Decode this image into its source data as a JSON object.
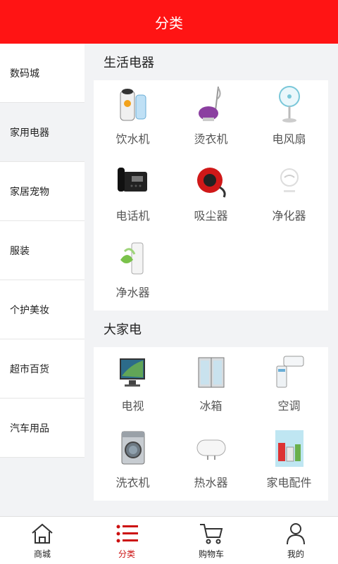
{
  "header": {
    "title": "分类"
  },
  "sidebar": {
    "items": [
      {
        "label": "数码城"
      },
      {
        "label": "家用电器"
      },
      {
        "label": "家居宠物"
      },
      {
        "label": "服装"
      },
      {
        "label": "个护美妆"
      },
      {
        "label": "超市百货"
      },
      {
        "label": "汽车用品"
      }
    ],
    "active_index": 1
  },
  "sections": [
    {
      "title": "生活电器",
      "items": [
        {
          "label": "饮水机",
          "icon": "water-dispenser-icon"
        },
        {
          "label": "烫衣机",
          "icon": "garment-steamer-icon"
        },
        {
          "label": "电风扇",
          "icon": "electric-fan-icon"
        },
        {
          "label": "电话机",
          "icon": "telephone-icon"
        },
        {
          "label": "吸尘器",
          "icon": "vacuum-cleaner-icon"
        },
        {
          "label": "净化器",
          "icon": "air-purifier-icon"
        },
        {
          "label": "净水器",
          "icon": "water-purifier-icon"
        }
      ]
    },
    {
      "title": "大家电",
      "items": [
        {
          "label": "电视",
          "icon": "television-icon"
        },
        {
          "label": "冰箱",
          "icon": "refrigerator-icon"
        },
        {
          "label": "空调",
          "icon": "air-conditioner-icon"
        },
        {
          "label": "洗衣机",
          "icon": "washing-machine-icon"
        },
        {
          "label": "热水器",
          "icon": "water-heater-icon"
        },
        {
          "label": "家电配件",
          "icon": "appliance-parts-icon"
        }
      ]
    }
  ],
  "bottom_nav": {
    "items": [
      {
        "label": "商城",
        "icon": "home-icon"
      },
      {
        "label": "分类",
        "icon": "list-icon"
      },
      {
        "label": "购物车",
        "icon": "cart-icon"
      },
      {
        "label": "我的",
        "icon": "user-icon"
      }
    ],
    "active_index": 1
  },
  "colors": {
    "header": "#ff1414",
    "active_nav": "#cc1010"
  }
}
